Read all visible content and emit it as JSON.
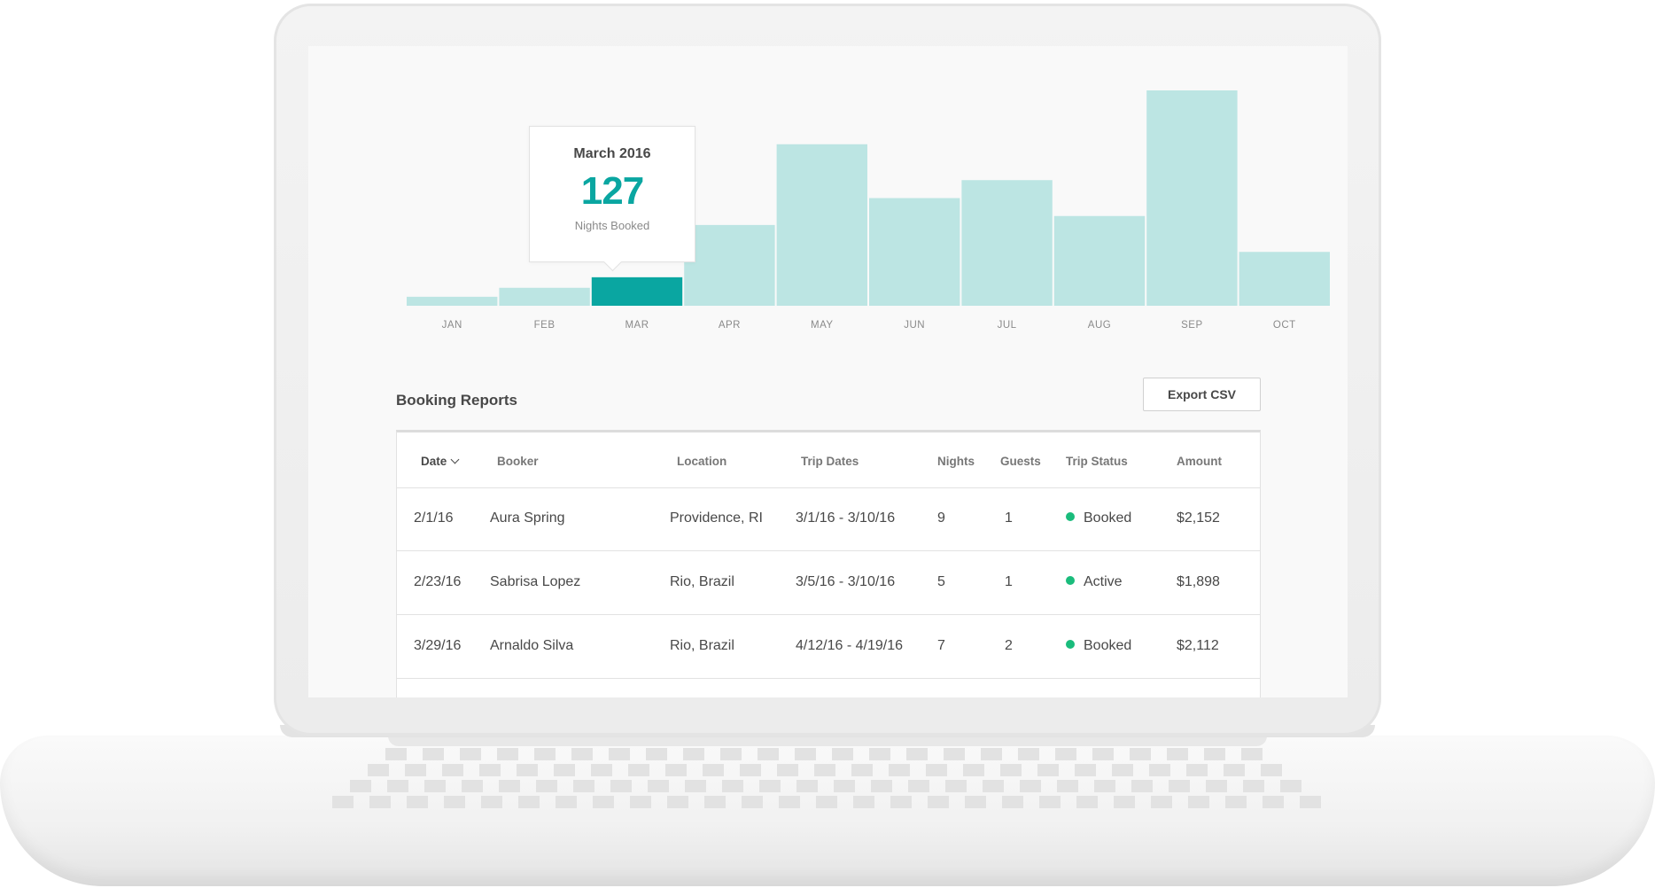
{
  "colors": {
    "accent": "#0aa6a1",
    "bar": "#bce5e3",
    "status_green": "#1abc7c",
    "text": "#484848",
    "muted": "#8a8a8a"
  },
  "chart_data": {
    "type": "bar",
    "categories": [
      "JAN",
      "FEB",
      "MAR",
      "APR",
      "MAY",
      "JUN",
      "JUL",
      "AUG",
      "SEP",
      "OCT"
    ],
    "values": [
      40,
      80,
      127,
      360,
      720,
      480,
      560,
      400,
      960,
      240
    ],
    "highlighted": "MAR",
    "title": "",
    "xlabel": "",
    "ylabel": "",
    "grid": false,
    "legend": "none"
  },
  "tooltip": {
    "title": "March 2016",
    "value": "127",
    "caption": "Nights Booked"
  },
  "reports": {
    "title": "Booking Reports",
    "export_label": "Export CSV"
  },
  "table": {
    "headers": {
      "date": "Date",
      "booker": "Booker",
      "location": "Location",
      "trip_dates": "Trip Dates",
      "nights": "Nights",
      "guests": "Guests",
      "status": "Trip Status",
      "amount": "Amount"
    },
    "rows": [
      {
        "date": "2/1/16",
        "booker": "Aura Spring",
        "location": "Providence, RI",
        "trip_dates": "3/1/16 - 3/10/16",
        "nights": "9",
        "guests": "1",
        "status": "Booked",
        "amount": "$2,152"
      },
      {
        "date": "2/23/16",
        "booker": "Sabrisa Lopez",
        "location": "Rio, Brazil",
        "trip_dates": "3/5/16 - 3/10/16",
        "nights": "5",
        "guests": "1",
        "status": "Active",
        "amount": "$1,898"
      },
      {
        "date": "3/29/16",
        "booker": "Arnaldo Silva",
        "location": "Rio, Brazil",
        "trip_dates": "4/12/16 - 4/19/16",
        "nights": "7",
        "guests": "2",
        "status": "Booked",
        "amount": "$2,112"
      }
    ]
  }
}
